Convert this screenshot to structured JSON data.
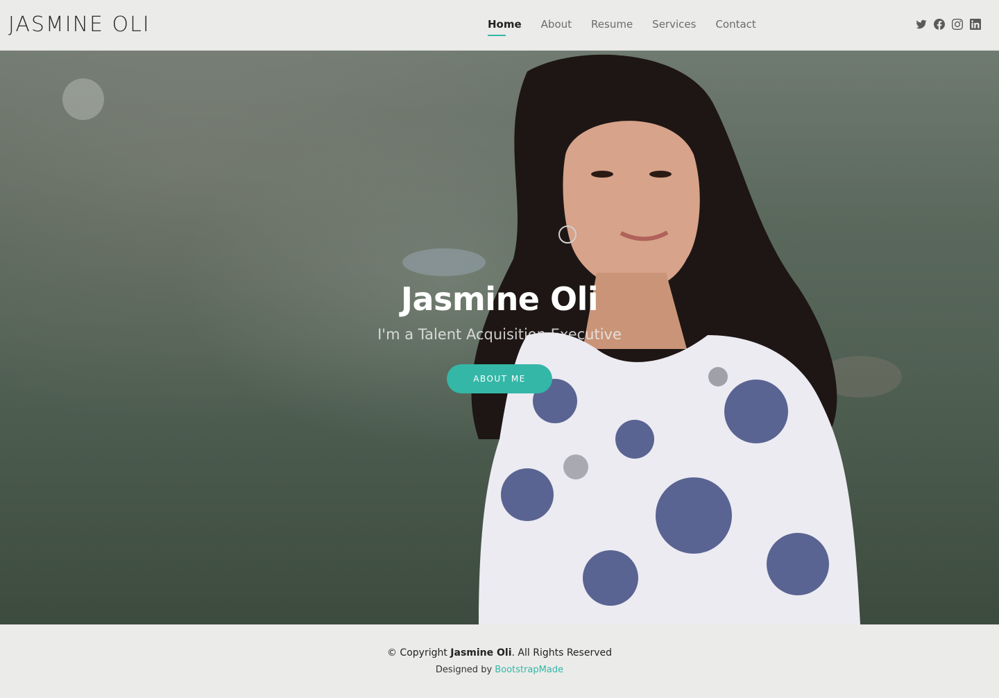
{
  "header": {
    "logo": "JASMINE OLI",
    "nav": [
      {
        "label": "Home",
        "active": true
      },
      {
        "label": "About",
        "active": false
      },
      {
        "label": "Resume",
        "active": false
      },
      {
        "label": "Services",
        "active": false
      },
      {
        "label": "Contact",
        "active": false
      }
    ],
    "social_icons": [
      "twitter-icon",
      "facebook-icon",
      "instagram-icon",
      "linkedin-icon"
    ]
  },
  "hero": {
    "title": "Jasmine Oli",
    "subtitle": "I'm a Talent Acquisition Executive",
    "button_label": "About Me"
  },
  "footer": {
    "copyright_prefix": "© Copyright",
    "copyright_name": "Jasmine Oli",
    "copyright_suffix": ". All Rights Reserved",
    "designed_by_prefix": "Designed by",
    "designer_link": "BootstrapMade"
  },
  "colors": {
    "accent": "#34b7a7",
    "header_bg": "#ebebe9"
  }
}
